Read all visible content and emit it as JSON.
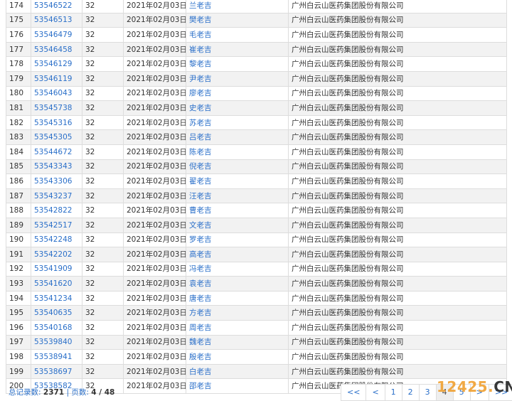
{
  "rows": [
    {
      "no": "174",
      "reg": "53546522",
      "cls": "32",
      "date": "2021年02月03日",
      "name": "兰老吉",
      "applicant": "广州白云山医药集团股份有限公司"
    },
    {
      "no": "175",
      "reg": "53546513",
      "cls": "32",
      "date": "2021年02月03日",
      "name": "樊老吉",
      "applicant": "广州白云山医药集团股份有限公司"
    },
    {
      "no": "176",
      "reg": "53546479",
      "cls": "32",
      "date": "2021年02月03日",
      "name": "毛老吉",
      "applicant": "广州白云山医药集团股份有限公司"
    },
    {
      "no": "177",
      "reg": "53546458",
      "cls": "32",
      "date": "2021年02月03日",
      "name": "崔老吉",
      "applicant": "广州白云山医药集团股份有限公司"
    },
    {
      "no": "178",
      "reg": "53546129",
      "cls": "32",
      "date": "2021年02月03日",
      "name": "黎老吉",
      "applicant": "广州白云山医药集团股份有限公司"
    },
    {
      "no": "179",
      "reg": "53546119",
      "cls": "32",
      "date": "2021年02月03日",
      "name": "尹老吉",
      "applicant": "广州白云山医药集团股份有限公司"
    },
    {
      "no": "180",
      "reg": "53546043",
      "cls": "32",
      "date": "2021年02月03日",
      "name": "廖老吉",
      "applicant": "广州白云山医药集团股份有限公司"
    },
    {
      "no": "181",
      "reg": "53545738",
      "cls": "32",
      "date": "2021年02月03日",
      "name": "史老吉",
      "applicant": "广州白云山医药集团股份有限公司"
    },
    {
      "no": "182",
      "reg": "53545316",
      "cls": "32",
      "date": "2021年02月03日",
      "name": "苏老吉",
      "applicant": "广州白云山医药集团股份有限公司"
    },
    {
      "no": "183",
      "reg": "53545305",
      "cls": "32",
      "date": "2021年02月03日",
      "name": "吕老吉",
      "applicant": "广州白云山医药集团股份有限公司"
    },
    {
      "no": "184",
      "reg": "53544672",
      "cls": "32",
      "date": "2021年02月03日",
      "name": "陈老吉",
      "applicant": "广州白云山医药集团股份有限公司"
    },
    {
      "no": "185",
      "reg": "53543343",
      "cls": "32",
      "date": "2021年02月03日",
      "name": "倪老吉",
      "applicant": "广州白云山医药集团股份有限公司"
    },
    {
      "no": "186",
      "reg": "53543306",
      "cls": "32",
      "date": "2021年02月03日",
      "name": "翟老吉",
      "applicant": "广州白云山医药集团股份有限公司"
    },
    {
      "no": "187",
      "reg": "53543237",
      "cls": "32",
      "date": "2021年02月03日",
      "name": "汪老吉",
      "applicant": "广州白云山医药集团股份有限公司"
    },
    {
      "no": "188",
      "reg": "53542822",
      "cls": "32",
      "date": "2021年02月03日",
      "name": "曹老吉",
      "applicant": "广州白云山医药集团股份有限公司"
    },
    {
      "no": "189",
      "reg": "53542517",
      "cls": "32",
      "date": "2021年02月03日",
      "name": "文老吉",
      "applicant": "广州白云山医药集团股份有限公司"
    },
    {
      "no": "190",
      "reg": "53542248",
      "cls": "32",
      "date": "2021年02月03日",
      "name": "罗老吉",
      "applicant": "广州白云山医药集团股份有限公司"
    },
    {
      "no": "191",
      "reg": "53542202",
      "cls": "32",
      "date": "2021年02月03日",
      "name": "高老吉",
      "applicant": "广州白云山医药集团股份有限公司"
    },
    {
      "no": "192",
      "reg": "53541909",
      "cls": "32",
      "date": "2021年02月03日",
      "name": "冯老吉",
      "applicant": "广州白云山医药集团股份有限公司"
    },
    {
      "no": "193",
      "reg": "53541620",
      "cls": "32",
      "date": "2021年02月03日",
      "name": "袁老吉",
      "applicant": "广州白云山医药集团股份有限公司"
    },
    {
      "no": "194",
      "reg": "53541234",
      "cls": "32",
      "date": "2021年02月03日",
      "name": "唐老吉",
      "applicant": "广州白云山医药集团股份有限公司"
    },
    {
      "no": "195",
      "reg": "53540635",
      "cls": "32",
      "date": "2021年02月03日",
      "name": "方老吉",
      "applicant": "广州白云山医药集团股份有限公司"
    },
    {
      "no": "196",
      "reg": "53540168",
      "cls": "32",
      "date": "2021年02月03日",
      "name": "周老吉",
      "applicant": "广州白云山医药集团股份有限公司"
    },
    {
      "no": "197",
      "reg": "53539840",
      "cls": "32",
      "date": "2021年02月03日",
      "name": "魏老吉",
      "applicant": "广州白云山医药集团股份有限公司"
    },
    {
      "no": "198",
      "reg": "53538941",
      "cls": "32",
      "date": "2021年02月03日",
      "name": "殷老吉",
      "applicant": "广州白云山医药集团股份有限公司"
    },
    {
      "no": "199",
      "reg": "53538697",
      "cls": "32",
      "date": "2021年02月03日",
      "name": "白老吉",
      "applicant": "广州白云山医药集团股份有限公司"
    },
    {
      "no": "200",
      "reg": "53538582",
      "cls": "32",
      "date": "2021年02月03日",
      "name": "邵老吉",
      "applicant": "广州白云山医药集团股份有限公司"
    }
  ],
  "footer": {
    "total_label": "总记录数:",
    "total_value": "2371",
    "separator": "|",
    "pages_label": "页数:",
    "pages_value": "4 / 48"
  },
  "pager": [
    {
      "label": "<<",
      "active": false
    },
    {
      "label": "<",
      "active": false
    },
    {
      "label": "1",
      "active": false
    },
    {
      "label": "2",
      "active": false
    },
    {
      "label": "3",
      "active": false
    },
    {
      "label": "4",
      "active": true
    },
    {
      "label": "5",
      "active": false
    },
    {
      "label": ">",
      "active": false
    },
    {
      "label": ">>",
      "active": false
    }
  ],
  "watermark": {
    "num": "12425",
    "dot": ".",
    "cn": "CN"
  }
}
